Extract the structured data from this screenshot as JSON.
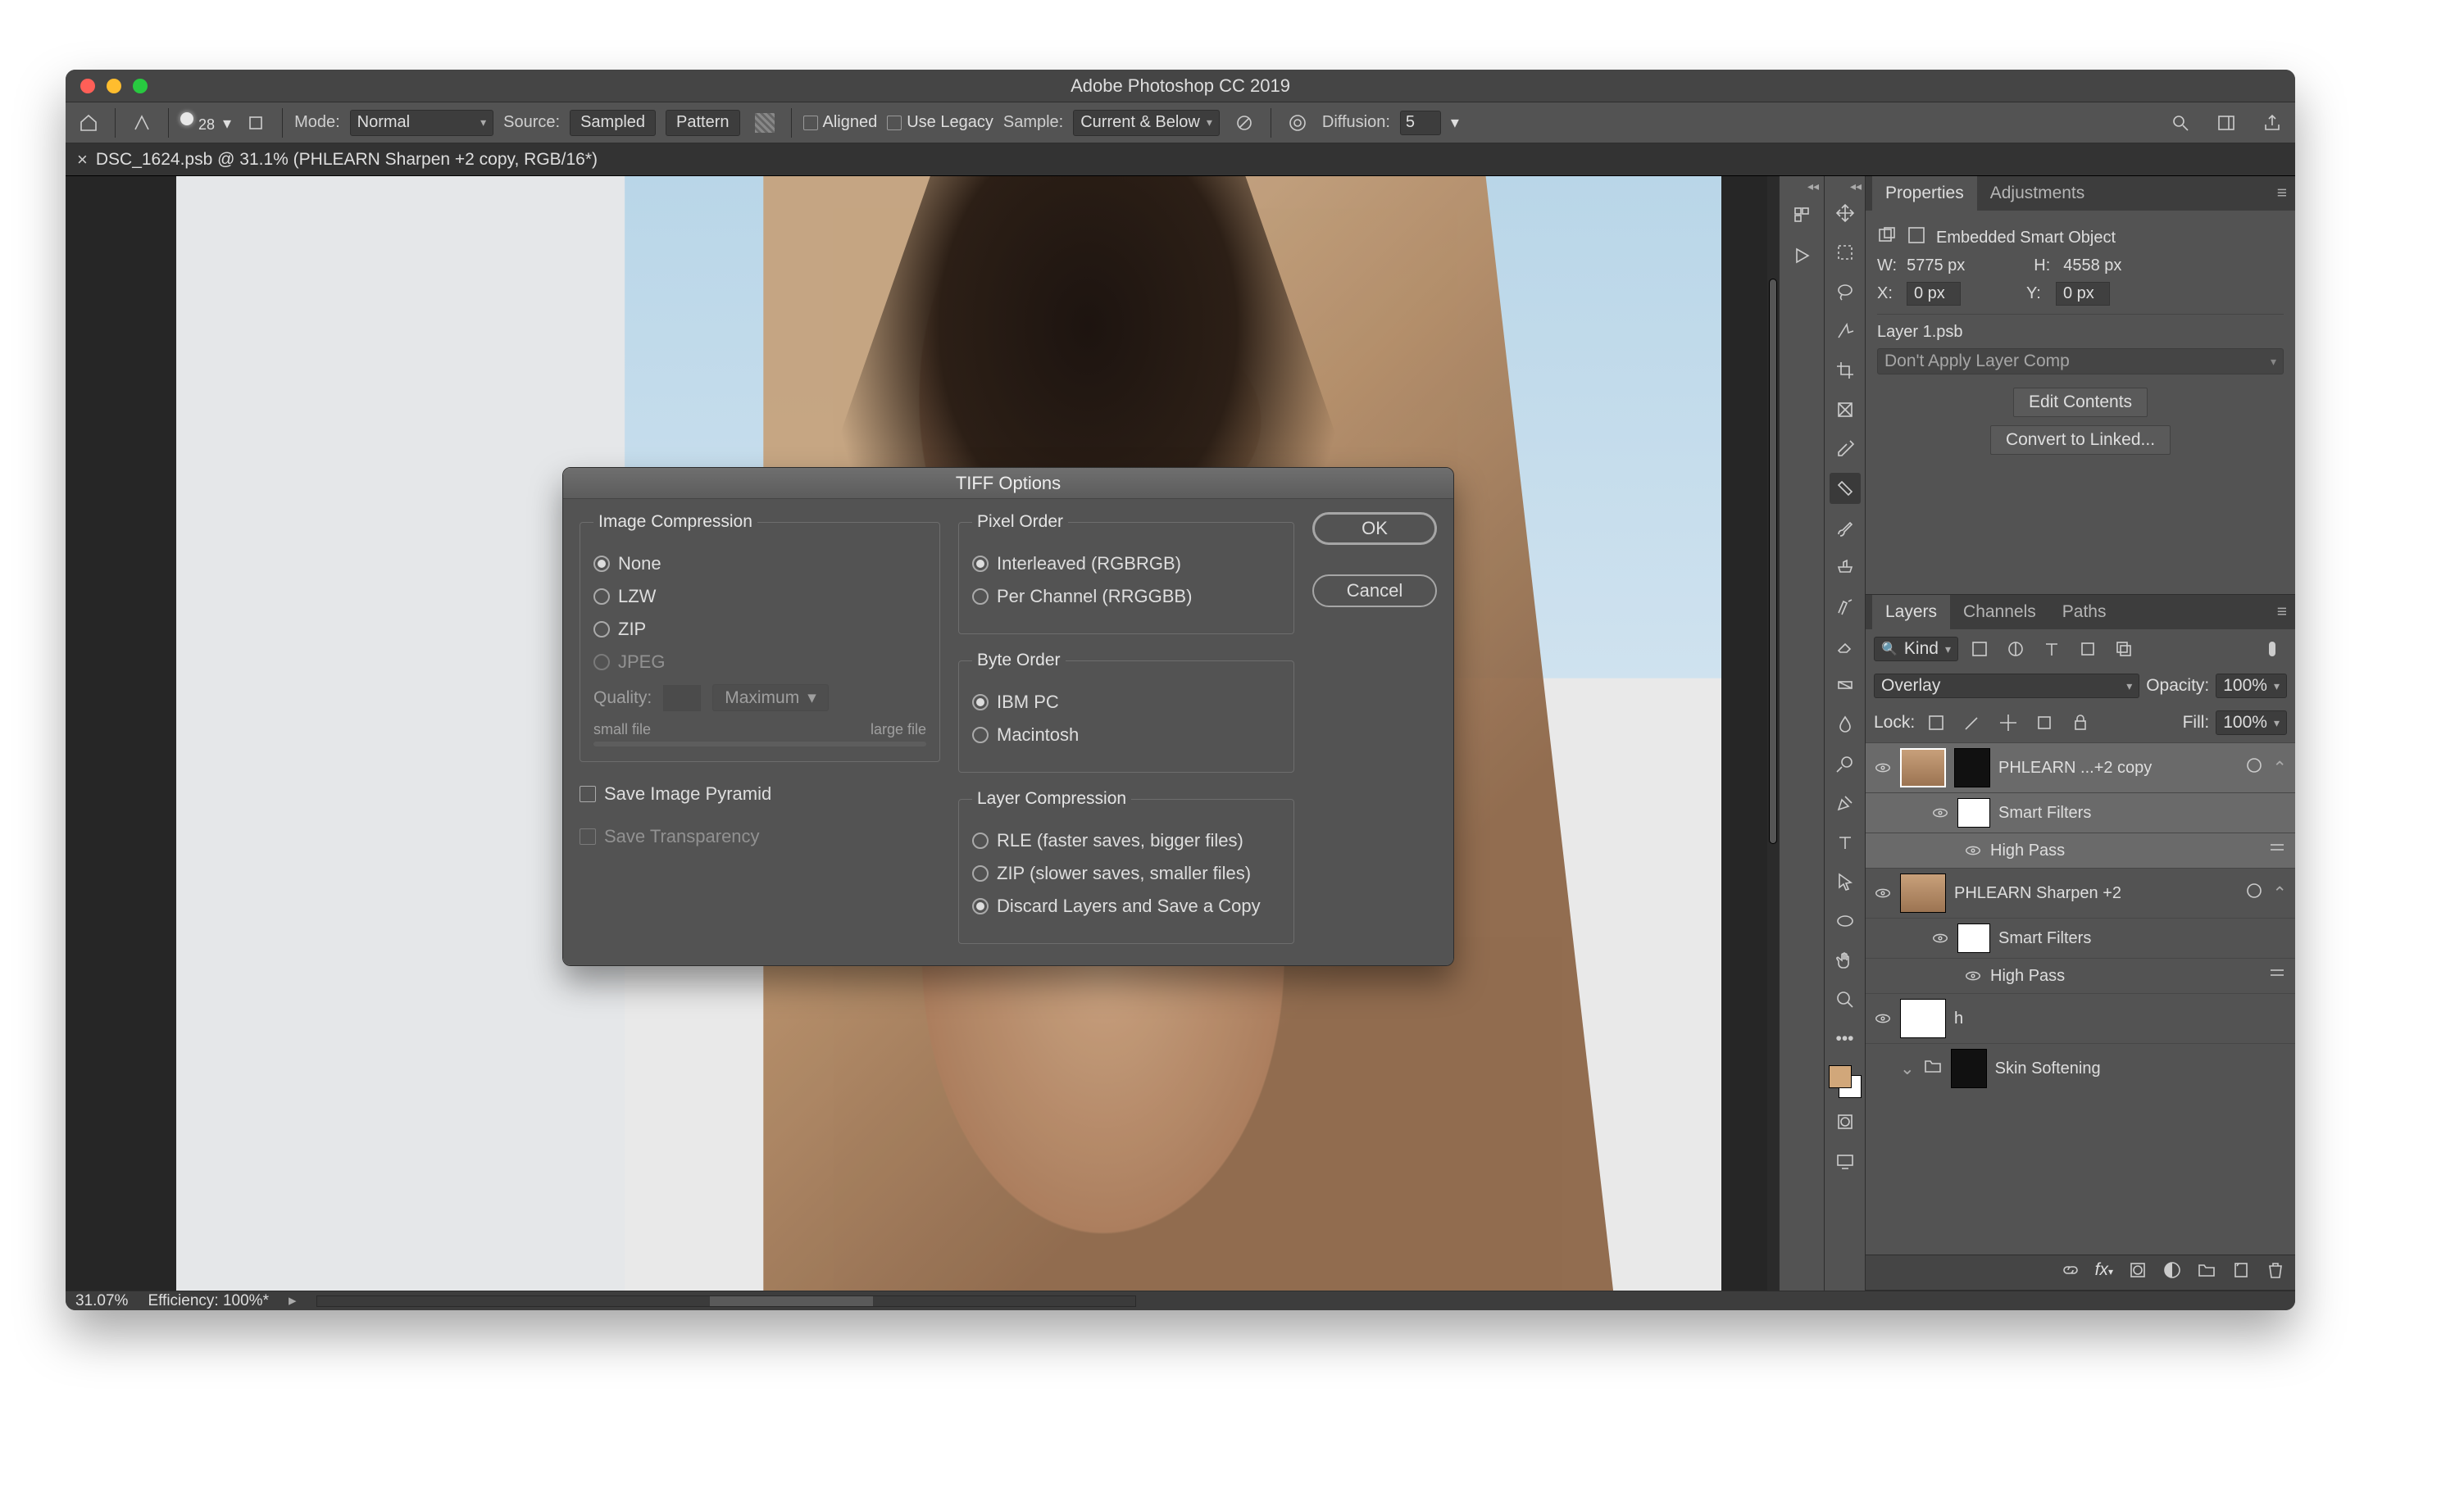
{
  "window": {
    "title": "Adobe Photoshop CC 2019"
  },
  "optionsbar": {
    "mode_label": "Mode:",
    "mode_value": "Normal",
    "source_label": "Source:",
    "sampled": "Sampled",
    "pattern": "Pattern",
    "aligned": "Aligned",
    "legacy": "Use Legacy",
    "sample_label": "Sample:",
    "sample_value": "Current & Below",
    "diffusion_label": "Diffusion:",
    "diffusion_value": "5",
    "brush_size": "28"
  },
  "document_tab": {
    "title": "DSC_1624.psb @ 31.1% (PHLEARN Sharpen +2 copy, RGB/16*)"
  },
  "status": {
    "zoom": "31.07%",
    "efficiency": "Efficiency: 100%*"
  },
  "properties": {
    "tab_properties": "Properties",
    "tab_adjustments": "Adjustments",
    "type": "Embedded Smart Object",
    "w_label": "W:",
    "w": "5775 px",
    "h_label": "H:",
    "h": "4558 px",
    "x_label": "X:",
    "x": "0 px",
    "y_label": "Y:",
    "y": "0 px",
    "source": "Layer 1.psb",
    "layer_comp": "Don't Apply Layer Comp",
    "edit": "Edit Contents",
    "convert": "Convert to Linked..."
  },
  "layers_panel": {
    "tab_layers": "Layers",
    "tab_channels": "Channels",
    "tab_paths": "Paths",
    "kind": "Kind",
    "blend": "Overlay",
    "opacity_label": "Opacity:",
    "opacity": "100%",
    "lock_label": "Lock:",
    "fill_label": "Fill:",
    "fill": "100%",
    "layers": [
      {
        "name": "PHLEARN ...+2 copy",
        "smart_filters": "Smart Filters",
        "filter": "High Pass",
        "selected": true
      },
      {
        "name": "PHLEARN Sharpen +2",
        "smart_filters": "Smart Filters",
        "filter": "High Pass",
        "selected": false
      },
      {
        "name": "h",
        "selected": false
      },
      {
        "name": "Skin Softening",
        "selected": false
      }
    ]
  },
  "dialog": {
    "title": "TIFF Options",
    "ok": "OK",
    "cancel": "Cancel",
    "image_compression": {
      "legend": "Image Compression",
      "none": "None",
      "lzw": "LZW",
      "zip": "ZIP",
      "jpeg": "JPEG",
      "quality_label": "Quality:",
      "quality_preset": "Maximum",
      "small": "small file",
      "large": "large file"
    },
    "save_pyramid": "Save Image Pyramid",
    "save_transparency": "Save Transparency",
    "pixel_order": {
      "legend": "Pixel Order",
      "interleaved": "Interleaved (RGBRGB)",
      "per_channel": "Per Channel (RRGGBB)"
    },
    "byte_order": {
      "legend": "Byte Order",
      "ibm": "IBM PC",
      "mac": "Macintosh"
    },
    "layer_compression": {
      "legend": "Layer Compression",
      "rle": "RLE (faster saves, bigger files)",
      "zip": "ZIP (slower saves, smaller files)",
      "discard": "Discard Layers and Save a Copy"
    }
  }
}
